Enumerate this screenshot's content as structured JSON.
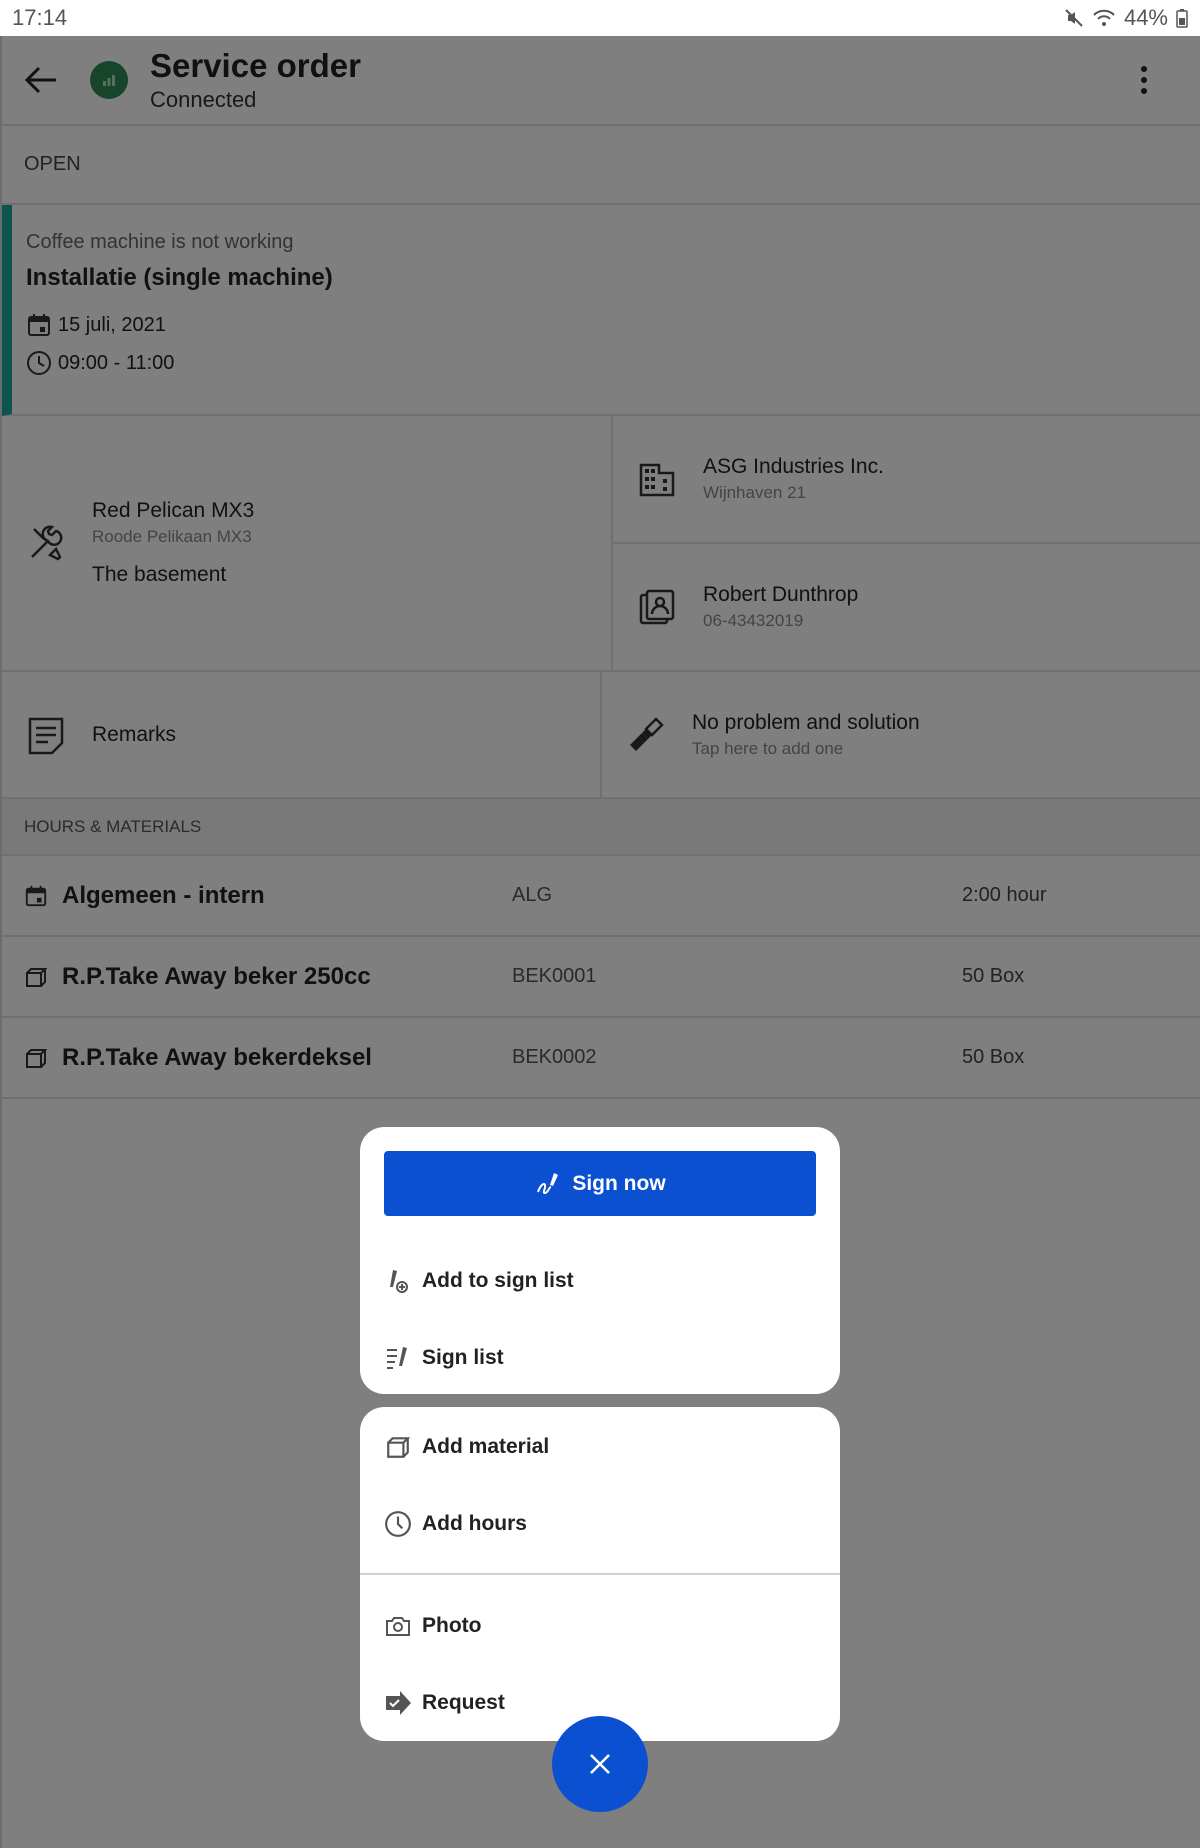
{
  "status_bar": {
    "time": "17:14",
    "battery": "44%"
  },
  "header": {
    "title": "Service order",
    "subtitle": "Connected"
  },
  "status": {
    "label": "OPEN"
  },
  "order": {
    "description": "Coffee machine is not working",
    "type": "Installatie (single machine)",
    "date": "15 juli, 2021",
    "time": "09:00 - 11:00",
    "accent_color": "#1aa89a"
  },
  "machine": {
    "name": "Red Pelican MX3",
    "alt_name": "Roode Pelikaan MX3",
    "location": "The basement",
    "icon": "tools-icon"
  },
  "company": {
    "name": "ASG Industries Inc.",
    "address": "Wijnhaven 21",
    "icon": "building-icon"
  },
  "contact": {
    "name": "Robert Dunthrop",
    "phone": "06-43432019",
    "icon": "contact-icon"
  },
  "remarks": {
    "label": "Remarks",
    "icon": "note-icon"
  },
  "problem": {
    "label": "No problem and solution",
    "hint": "Tap here to add one",
    "icon": "flashlight-icon"
  },
  "hours_materials": {
    "header": "HOURS & MATERIALS",
    "rows": [
      {
        "icon": "calendar-icon",
        "name": "Algemeen - intern",
        "code": "ALG",
        "qty": "2:00 hour"
      },
      {
        "icon": "box-icon",
        "name": "R.P.Take Away beker 250cc",
        "code": "BEK0001",
        "qty": "50 Box"
      },
      {
        "icon": "box-icon",
        "name": "R.P.Take Away bekerdeksel",
        "code": "BEK0002",
        "qty": "50 Box"
      }
    ]
  },
  "menu": {
    "sign_now": "Sign now",
    "add_to_sign_list": "Add to sign list",
    "sign_list": "Sign list",
    "add_material": "Add material",
    "add_hours": "Add hours",
    "photo": "Photo",
    "request": "Request"
  },
  "colors": {
    "primary": "#0b50d0",
    "connected": "#2e8b57"
  }
}
